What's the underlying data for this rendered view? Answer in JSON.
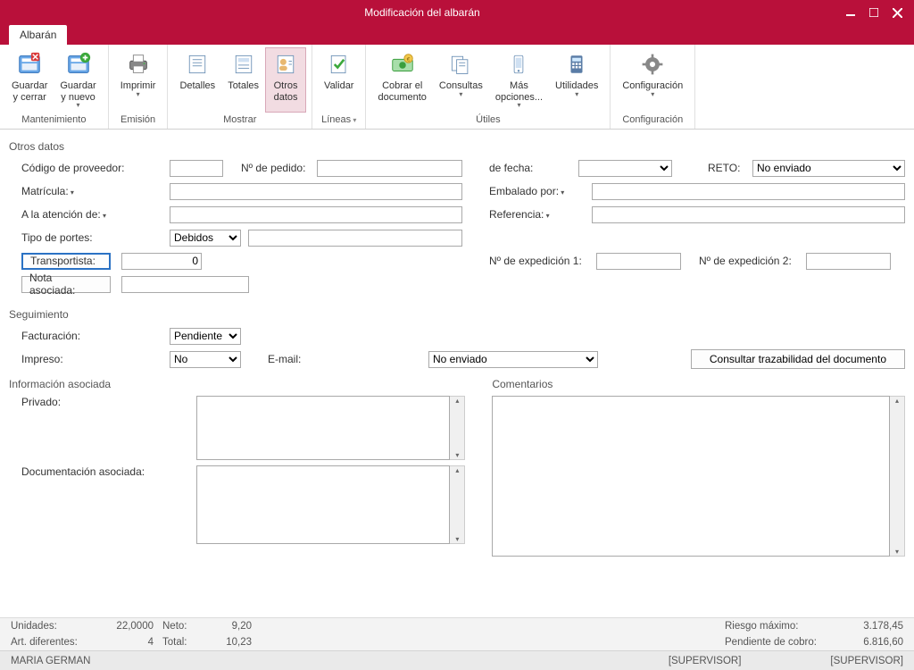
{
  "title": "Modificación del albarán",
  "tab": "Albarán",
  "ribbon": {
    "mantenimiento": {
      "label": "Mantenimiento",
      "guardar_cerrar": "Guardar\ny cerrar",
      "guardar_nuevo": "Guardar\ny nuevo"
    },
    "emision": {
      "label": "Emisión",
      "imprimir": "Imprimir"
    },
    "mostrar": {
      "label": "Mostrar",
      "detalles": "Detalles",
      "totales": "Totales",
      "otros_datos": "Otros\ndatos"
    },
    "lineas": {
      "label": "Líneas",
      "validar": "Validar"
    },
    "utiles": {
      "label": "Útiles",
      "cobrar": "Cobrar el\ndocumento",
      "consultas": "Consultas",
      "mas_opciones": "Más\nopciones...",
      "utilidades": "Utilidades"
    },
    "config": {
      "label": "Configuración",
      "config": "Configuración"
    }
  },
  "sections": {
    "otros_datos": "Otros datos",
    "seguimiento": "Seguimiento",
    "info_asociada": "Información asociada",
    "comentarios": "Comentarios"
  },
  "labels": {
    "codigo_proveedor": "Código de proveedor:",
    "n_pedido": "Nº de pedido:",
    "de_fecha": "de fecha:",
    "reto": "RETO:",
    "matricula": "Matrícula:",
    "embalado_por": "Embalado por:",
    "atencion_de": "A la atención de:",
    "referencia": "Referencia:",
    "tipo_portes": "Tipo de portes:",
    "transportista": "Transportista:",
    "n_exp1": "Nº de expedición 1:",
    "n_exp2": "Nº de expedición 2:",
    "nota_asociada": "Nota asociada:",
    "facturacion": "Facturación:",
    "impreso": "Impreso:",
    "email": "E-mail:",
    "trazabilidad": "Consultar trazabilidad del documento",
    "privado": "Privado:",
    "doc_asociada": "Documentación asociada:"
  },
  "values": {
    "reto": "No enviado",
    "tipo_portes": "Debidos",
    "transportista": "0",
    "facturacion": "Pendiente",
    "impreso": "No",
    "email": "No enviado"
  },
  "footer": {
    "unidades_l": "Unidades:",
    "unidades_v": "22,0000",
    "neto_l": "Neto:",
    "neto_v": "9,20",
    "art_dif_l": "Art. diferentes:",
    "art_dif_v": "4",
    "total_l": "Total:",
    "total_v": "10,23",
    "riesgo_l": "Riesgo máximo:",
    "riesgo_v": "3.178,45",
    "pendiente_l": "Pendiente de cobro:",
    "pendiente_v": "6.816,60"
  },
  "status": {
    "user": "MARIA GERMAN",
    "sup1": "[SUPERVISOR]",
    "sup2": "[SUPERVISOR]"
  }
}
